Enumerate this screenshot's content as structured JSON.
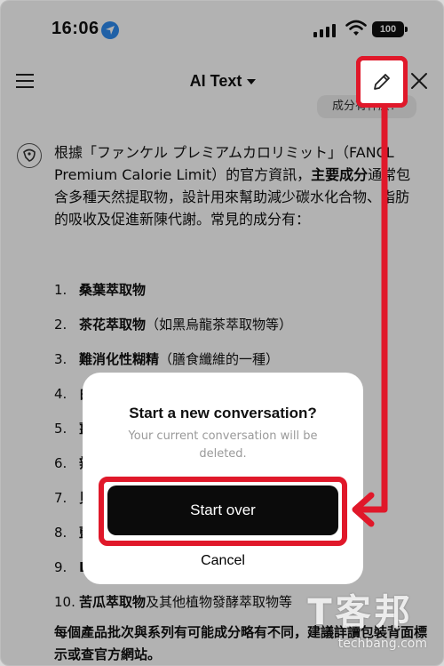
{
  "status_bar": {
    "time": "16:06",
    "battery": "100",
    "icons": [
      "location-icon",
      "signal-icon",
      "wifi-icon",
      "battery-icon"
    ]
  },
  "header": {
    "title": "AI Text",
    "chip_text": "成分有什麼？",
    "icons": [
      "menu-icon",
      "pencil-icon",
      "close-icon",
      "chevron-down-icon"
    ]
  },
  "response": {
    "intro_part1": "根據「ファンケル プレミアムカロリミット」（FANCL Premium Calorie Limit）的官方資訊，",
    "intro_bold": "主要成分",
    "intro_part2": "通常包含多種天然提取物，設計用來幫助減少碳水化合物、脂肪的吸收及促進新陳代謝。常見的成分有：",
    "items": [
      {
        "num": "1.",
        "name": "桑葉萃取物",
        "note": ""
      },
      {
        "num": "2.",
        "name": "茶花萃取物",
        "note": "（如黑烏龍茶萃取物等）"
      },
      {
        "num": "3.",
        "name": "難消化性糊精",
        "note": "（膳食纖維的一種）"
      },
      {
        "num": "4.",
        "name": "白",
        "note": ""
      },
      {
        "num": "5.",
        "name": "薑",
        "note": ""
      },
      {
        "num": "6.",
        "name": "辣",
        "note": ""
      },
      {
        "num": "7.",
        "name": "貝",
        "note": ""
      },
      {
        "num": "8.",
        "name": "藍",
        "note": ""
      },
      {
        "num": "9.",
        "name": "L",
        "note": ""
      },
      {
        "num": "10.",
        "name": "苦瓜萃取物",
        "note": " 及其他植物發酵萃取物等"
      }
    ],
    "footer": "每個產品批次與系列有可能成分略有不同，建議詳讀包裝背面標示或查官方網站。"
  },
  "dialog": {
    "title": "Start a new conversation?",
    "message": "Your current conversation will be deleted.",
    "start_label": "Start over",
    "cancel_label": "Cancel"
  },
  "watermark": {
    "big": "T客邦",
    "small": "techbang.com"
  },
  "colors": {
    "highlight": "#e0182a",
    "primary_button": "#0b0b0b",
    "location": "#2f8cf0"
  }
}
